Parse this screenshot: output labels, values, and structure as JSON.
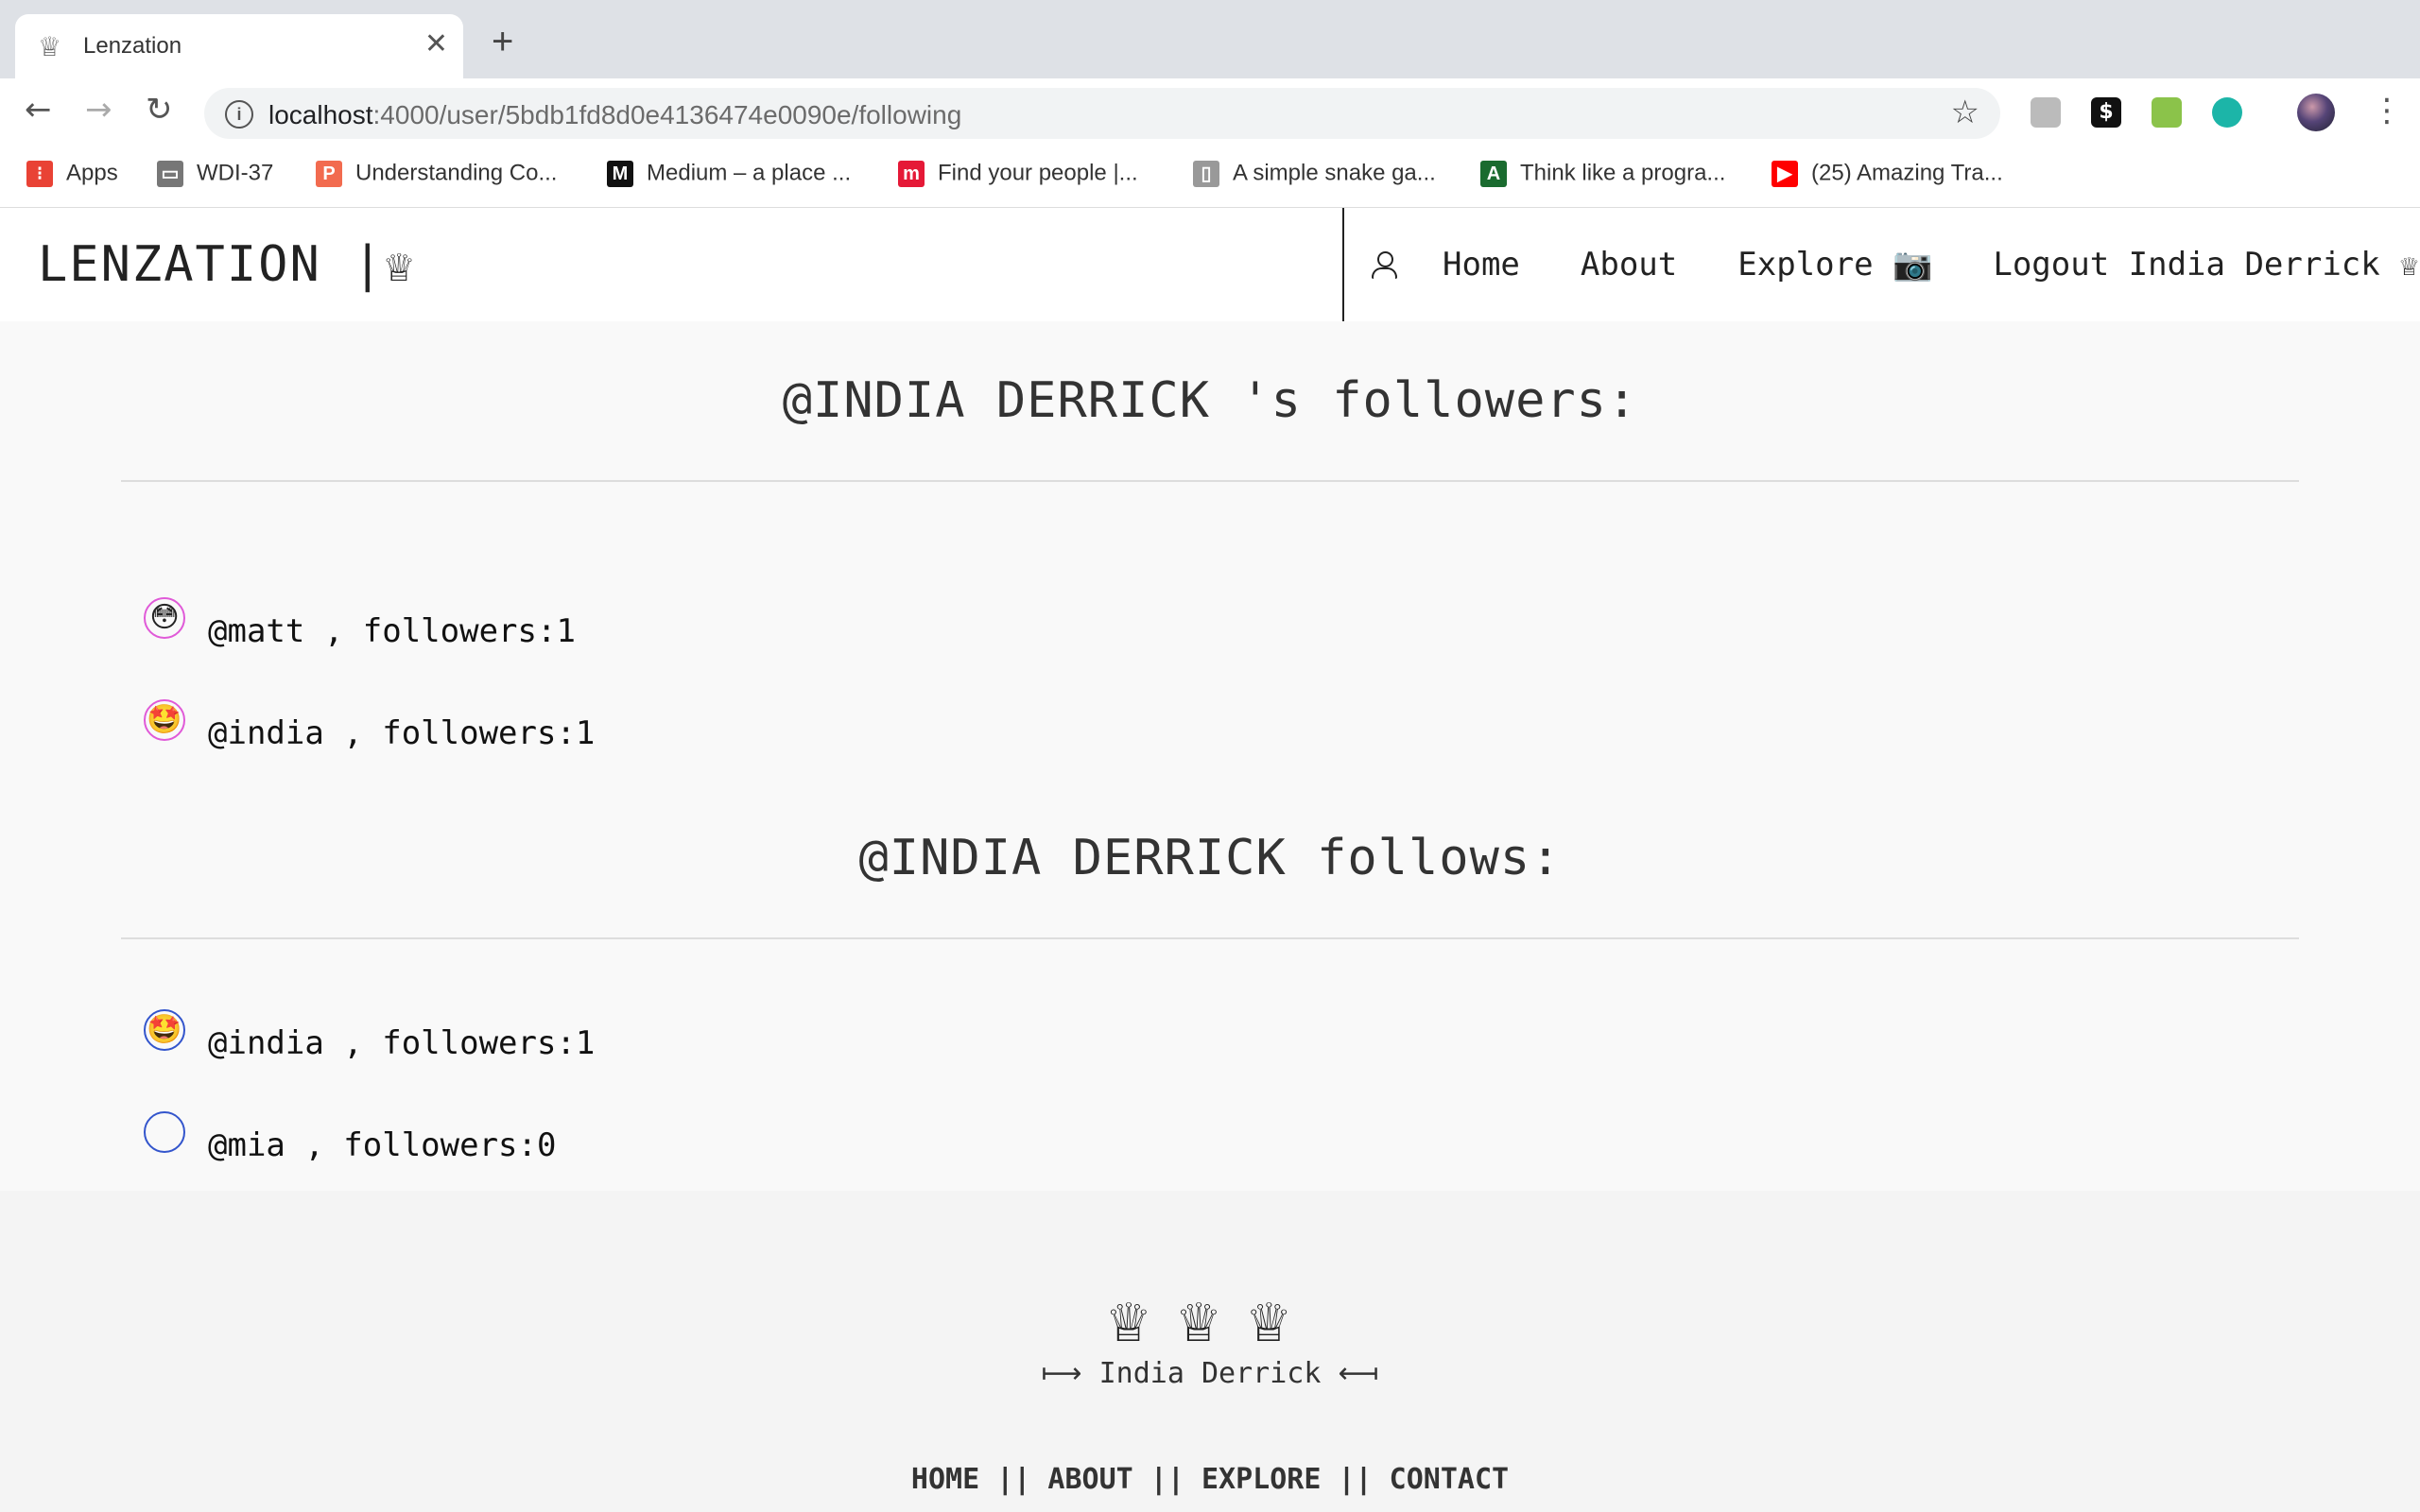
{
  "browser": {
    "tab_title": "Lenzation",
    "tab_icon": "♕",
    "tab_close": "✕",
    "new_tab": "+",
    "back": "←",
    "forward": "→",
    "reload": "↻",
    "url_host": "localhost",
    "url_rest": ":4000/user/5bdb1fd8d0e4136474e0090e/following",
    "star": "☆",
    "menu": "⋮",
    "bookmarks": [
      {
        "label": "Apps",
        "color": "#e94235",
        "glyph": "⁝"
      },
      {
        "label": "WDI-37",
        "color": "#777777",
        "glyph": "▭"
      },
      {
        "label": "Understanding Co...",
        "color": "#f26b4f",
        "glyph": "P"
      },
      {
        "label": "Medium – a place ...",
        "color": "#111111",
        "glyph": "M"
      },
      {
        "label": "Find your people |...",
        "color": "#e51937",
        "glyph": "m"
      },
      {
        "label": "A simple snake ga...",
        "color": "#999999",
        "glyph": "▯"
      },
      {
        "label": "Think like a progra...",
        "color": "#1a6b2f",
        "glyph": "A"
      },
      {
        "label": "(25) Amazing Tra...",
        "color": "#ff0000",
        "glyph": "▶"
      }
    ]
  },
  "site": {
    "logo": "LENZATION |♕",
    "nav": {
      "home": "Home",
      "about": "About",
      "explore": "Explore 📷",
      "logout": "Logout India Derrick ♕"
    }
  },
  "followers": {
    "heading": "@INDIA DERRICK 's followers:",
    "items": [
      {
        "avatar": "😳",
        "text": "@matt , followers:1"
      },
      {
        "avatar": "🤩",
        "text": "@india , followers:1"
      }
    ]
  },
  "follows": {
    "heading": "@INDIA DERRICK follows:",
    "items": [
      {
        "avatar": "🤩",
        "text": "@india , followers:1"
      },
      {
        "avatar": "",
        "text": "@mia , followers:0"
      }
    ]
  },
  "footer": {
    "crowns": "♕♕♕",
    "signature": "⟼ India Derrick ⟻",
    "nav": "HOME || ABOUT || EXPLORE || CONTACT"
  }
}
